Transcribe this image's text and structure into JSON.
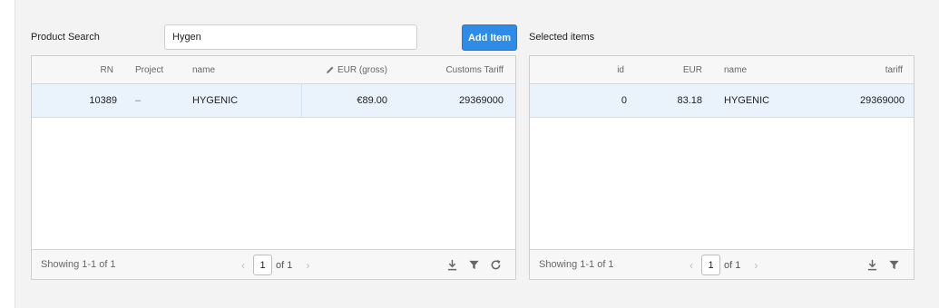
{
  "product_search": {
    "label": "Product Search",
    "input_value": "Hygen",
    "add_button": "Add Item"
  },
  "products_grid": {
    "headers": [
      "RN",
      "Project",
      "name",
      "EUR (gross)",
      "Customs Tariff"
    ],
    "rows": [
      [
        "10389",
        "–",
        "HYGENIC",
        "€89.00",
        "29369000"
      ]
    ],
    "footer": {
      "status": "Showing 1-1 of 1",
      "page": "1",
      "of_pages": "of 1"
    }
  },
  "selected_items": {
    "label": "Selected items",
    "headers": [
      "id",
      "EUR",
      "name",
      "tariff"
    ],
    "rows": [
      [
        "0",
        "83.18",
        "HYGENIC",
        "29369000"
      ]
    ],
    "footer": {
      "status": "Showing 1-1 of 1",
      "page": "1",
      "of_pages": "of 1"
    }
  },
  "icons": {
    "edit": "pencil-icon",
    "download": "download-icon",
    "filter": "filter-icon",
    "refresh": "refresh-icon",
    "prev": "chevron-left-icon",
    "next": "chevron-right-icon"
  },
  "colors": {
    "accent": "#2f8ce6",
    "selected_row": "#eaf3fb"
  }
}
